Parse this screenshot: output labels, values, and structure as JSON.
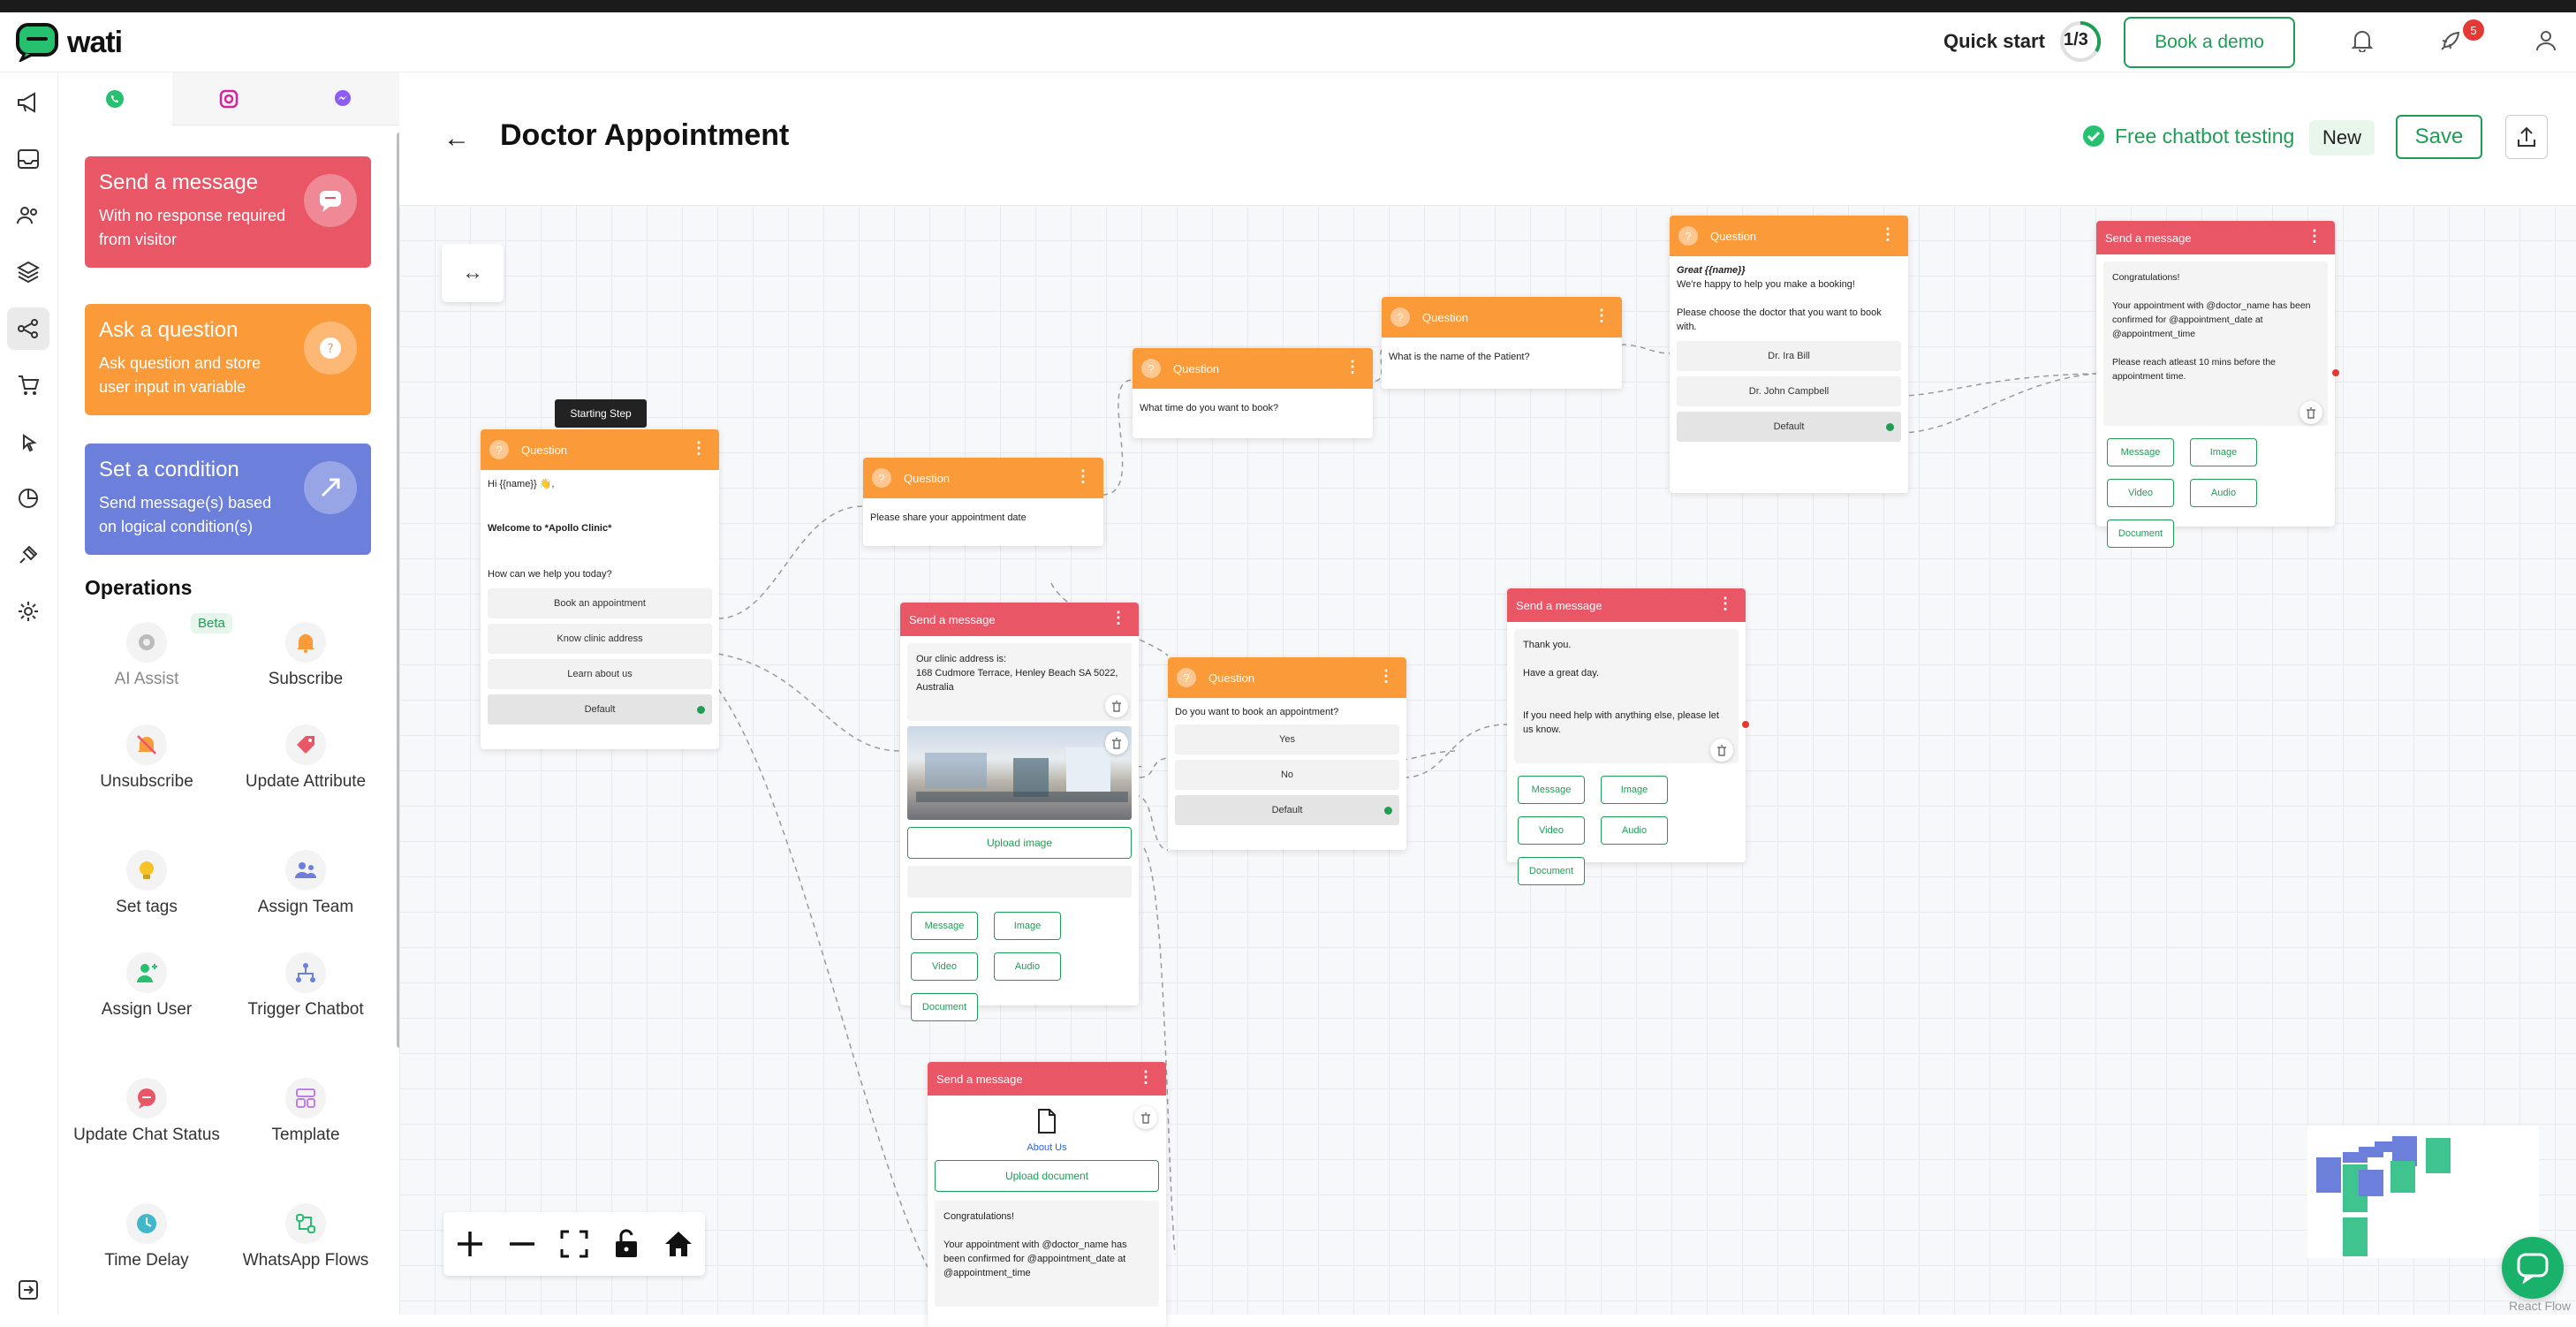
{
  "app": {
    "name": "wati"
  },
  "topbar": {
    "quick_start": "Quick start",
    "quick_start_progress": "1/3",
    "book_demo": "Book a demo",
    "notification_count": "5"
  },
  "panel": {
    "tabs": [
      "whatsapp-icon",
      "instagram-icon",
      "messenger-icon"
    ],
    "cards": [
      {
        "title": "Send a message",
        "subtitle": "With no response required from visitor",
        "color": "#e95767"
      },
      {
        "title": "Ask a question",
        "subtitle": "Ask question and store user input in variable",
        "color": "#fb9a38"
      },
      {
        "title": "Set a condition",
        "subtitle": "Send message(s) based on logical condition(s)",
        "color": "#6b7fdb"
      }
    ],
    "operations_title": "Operations",
    "beta": "Beta",
    "operations": [
      "AI Assist",
      "Subscribe",
      "Unsubscribe",
      "Update Attribute",
      "Set tags",
      "Assign Team",
      "Assign User",
      "Trigger Chatbot",
      "Update Chat Status",
      "Template",
      "Time Delay",
      "WhatsApp Flows"
    ]
  },
  "header": {
    "title": "Doctor Appointment",
    "free_testing": "Free chatbot testing",
    "new_badge": "New",
    "save": "Save"
  },
  "flow": {
    "starting_step": "Starting Step",
    "question_label": "Question",
    "message_label": "Send a message",
    "start_node": {
      "lines": [
        "Hi {{name}} 👋,",
        "Welcome to *Apollo Clinic*",
        "How can we help you today?"
      ],
      "options": [
        "Book an appointment",
        "Know clinic address",
        "Learn about us"
      ],
      "default": "Default"
    },
    "date_node": {
      "text": "Please share your appointment date"
    },
    "time_node": {
      "text": "What time do you want to book?"
    },
    "patient_node": {
      "text": "What is the name of the Patient?"
    },
    "doctor_node": {
      "greet": "Great {{name}}",
      "text": "We're happy to help you make a booking!\n\nPlease choose the doctor that you want to book with.",
      "options": [
        "Dr. Ira Bill",
        "Dr. John Campbell"
      ],
      "default": "Default"
    },
    "confirm_node": {
      "text": "Congratulations!\n\nYour appointment with @doctor_name has been confirmed for @appointment_date at @appointment_time\n\nPlease reach atleast 10 mins before the appointment time."
    },
    "address_node": {
      "text": "Our clinic address is:\n168 Cudmore Terrace, Henley Beach SA 5022, Australia",
      "upload": "Upload image"
    },
    "book_node": {
      "text": "Do you want to book an appointment?",
      "options": [
        "Yes",
        "No"
      ],
      "default": "Default"
    },
    "thanks_node": {
      "text": "Thank you.\n\nHave a great day.\n\n\nIf you need help with anything else, please let us know."
    },
    "about_node": {
      "file": "About Us",
      "upload": "Upload document",
      "text": "Congratulations!\n\nYour appointment with @doctor_name has been confirmed for @appointment_date at @appointment_time"
    },
    "chips": [
      "Message",
      "Image",
      "Video",
      "Audio",
      "Document"
    ]
  },
  "footer": {
    "react_flow": "React Flow"
  },
  "colors": {
    "accent": "#1f9d55",
    "question": "#fb9a38",
    "message": "#e95767",
    "condition": "#6b7fdb"
  }
}
